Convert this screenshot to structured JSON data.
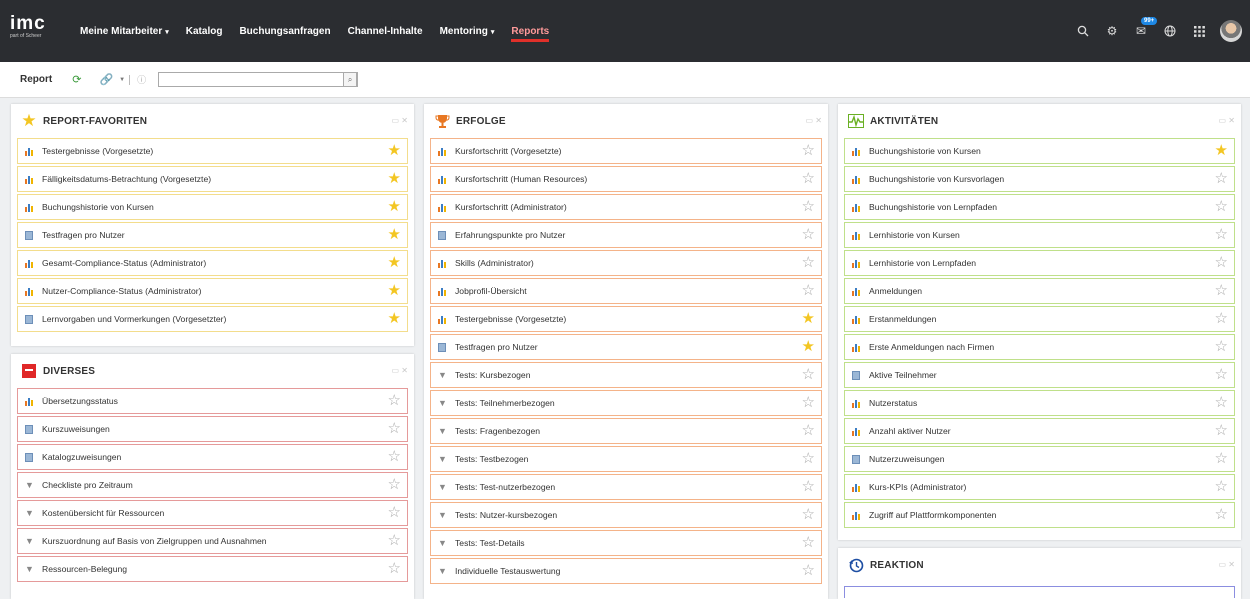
{
  "nav": {
    "logo_main": "imc",
    "logo_sub": "part of Scheer",
    "items": [
      {
        "label": "Meine Mitarbeiter",
        "dropdown": true,
        "active": false
      },
      {
        "label": "Katalog",
        "dropdown": false,
        "active": false
      },
      {
        "label": "Buchungsanfragen",
        "dropdown": false,
        "active": false
      },
      {
        "label": "Channel-Inhalte",
        "dropdown": false,
        "active": false
      },
      {
        "label": "Mentoring",
        "dropdown": true,
        "active": false
      },
      {
        "label": "Reports",
        "dropdown": false,
        "active": true
      }
    ],
    "right_icons": [
      "search-icon",
      "settings-icon",
      "messages-icon",
      "globe-icon",
      "apps-grid-icon",
      "avatar"
    ],
    "messages_badge": "99+"
  },
  "toolbar": {
    "title": "Report",
    "search_value": ""
  },
  "panels": {
    "favoriten": {
      "title": "REPORT-FAVORITEN",
      "items": [
        {
          "label": "Testergebnisse (Vorgesetzte)",
          "icon": "chart",
          "fav": true
        },
        {
          "label": "Fälligkeitsdatums-Betrachtung (Vorgesetzte)",
          "icon": "chart",
          "fav": true
        },
        {
          "label": "Buchungshistorie von Kursen",
          "icon": "chart",
          "fav": true
        },
        {
          "label": "Testfragen pro Nutzer",
          "icon": "doc",
          "fav": true
        },
        {
          "label": "Gesamt-Compliance-Status (Administrator)",
          "icon": "chart",
          "fav": true
        },
        {
          "label": "Nutzer-Compliance-Status (Administrator)",
          "icon": "chart",
          "fav": true
        },
        {
          "label": "Lernvorgaben und Vormerkungen (Vorgesetzter)",
          "icon": "doc",
          "fav": true
        }
      ]
    },
    "diverses": {
      "title": "DIVERSES",
      "items": [
        {
          "label": "Übersetzungsstatus",
          "icon": "chart",
          "fav": false
        },
        {
          "label": "Kurszuweisungen",
          "icon": "doc",
          "fav": false
        },
        {
          "label": "Katalogzuweisungen",
          "icon": "doc",
          "fav": false
        },
        {
          "label": "Checkliste pro Zeitraum",
          "icon": "filter",
          "fav": false
        },
        {
          "label": "Kostenübersicht für Ressourcen",
          "icon": "filter",
          "fav": false
        },
        {
          "label": "Kurszuordnung auf Basis von Zielgruppen und Ausnahmen",
          "icon": "filter",
          "fav": false
        },
        {
          "label": "Ressourcen-Belegung",
          "icon": "filter",
          "fav": false
        }
      ]
    },
    "erfolge": {
      "title": "ERFOLGE",
      "items": [
        {
          "label": "Kursfortschritt (Vorgesetzte)",
          "icon": "chart",
          "fav": false
        },
        {
          "label": "Kursfortschritt (Human Resources)",
          "icon": "chart",
          "fav": false
        },
        {
          "label": "Kursfortschritt (Administrator)",
          "icon": "chart",
          "fav": false
        },
        {
          "label": "Erfahrungspunkte pro Nutzer",
          "icon": "doc",
          "fav": false
        },
        {
          "label": "Skills (Administrator)",
          "icon": "chart",
          "fav": false
        },
        {
          "label": "Jobprofil-Übersicht",
          "icon": "chart",
          "fav": false
        },
        {
          "label": "Testergebnisse (Vorgesetzte)",
          "icon": "chart",
          "fav": true
        },
        {
          "label": "Testfragen pro Nutzer",
          "icon": "doc",
          "fav": true
        },
        {
          "label": "Tests: Kursbezogen",
          "icon": "filter",
          "fav": false
        },
        {
          "label": "Tests: Teilnehmerbezogen",
          "icon": "filter",
          "fav": false
        },
        {
          "label": "Tests: Fragenbezogen",
          "icon": "filter",
          "fav": false
        },
        {
          "label": "Tests: Testbezogen",
          "icon": "filter",
          "fav": false
        },
        {
          "label": "Tests: Test-nutzerbezogen",
          "icon": "filter",
          "fav": false
        },
        {
          "label": "Tests: Nutzer-kursbezogen",
          "icon": "filter",
          "fav": false
        },
        {
          "label": "Tests: Test-Details",
          "icon": "filter",
          "fav": false
        },
        {
          "label": "Individuelle Testauswertung",
          "icon": "filter",
          "fav": false
        }
      ]
    },
    "aktivitaeten": {
      "title": "AKTIVITÄTEN",
      "items": [
        {
          "label": "Buchungshistorie von Kursen",
          "icon": "chart",
          "fav": true
        },
        {
          "label": "Buchungshistorie von Kursvorlagen",
          "icon": "chart",
          "fav": false
        },
        {
          "label": "Buchungshistorie von Lernpfaden",
          "icon": "chart",
          "fav": false
        },
        {
          "label": "Lernhistorie von Kursen",
          "icon": "chart",
          "fav": false
        },
        {
          "label": "Lernhistorie von Lernpfaden",
          "icon": "chart",
          "fav": false
        },
        {
          "label": "Anmeldungen",
          "icon": "chart",
          "fav": false
        },
        {
          "label": "Erstanmeldungen",
          "icon": "chart",
          "fav": false
        },
        {
          "label": "Erste Anmeldungen nach Firmen",
          "icon": "chart",
          "fav": false
        },
        {
          "label": "Aktive Teilnehmer",
          "icon": "doc",
          "fav": false
        },
        {
          "label": "Nutzerstatus",
          "icon": "chart",
          "fav": false
        },
        {
          "label": "Anzahl aktiver Nutzer",
          "icon": "chart",
          "fav": false
        },
        {
          "label": "Nutzerzuweisungen",
          "icon": "doc",
          "fav": false
        },
        {
          "label": "Kurs-KPIs (Administrator)",
          "icon": "chart",
          "fav": false
        },
        {
          "label": "Zugriff auf Plattformkomponenten",
          "icon": "chart",
          "fav": false
        }
      ]
    },
    "reaktion": {
      "title": "REAKTION",
      "items": []
    }
  },
  "colors": {
    "nav_bg": "#2b2d31",
    "active_underline": "#e0302a",
    "favoriten_border": "#f3dd8c",
    "diverses_border": "#e59a9a",
    "erfolge_border": "#f4b389",
    "aktivitaeten_border": "#bfe08a",
    "star_on": "#f3c623"
  }
}
